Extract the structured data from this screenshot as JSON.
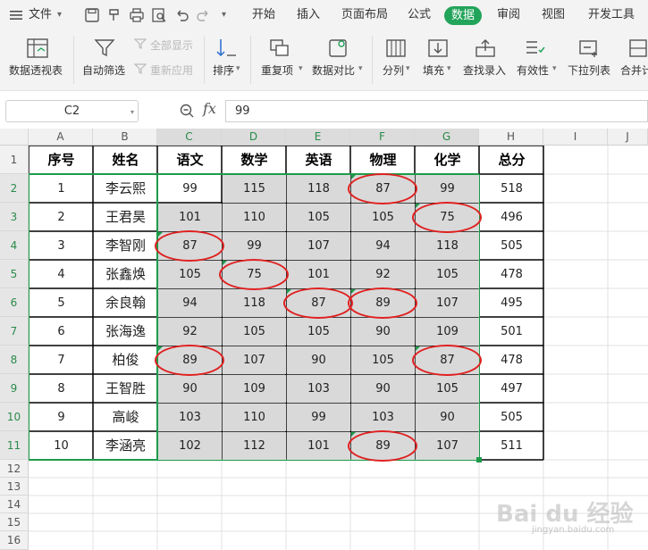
{
  "menubar": {
    "file_label": "文件",
    "file_caret": "▾",
    "more_label": "▾",
    "tabs": [
      "开始",
      "插入",
      "页面布局",
      "公式",
      "数据",
      "审阅",
      "视图",
      "开发工具"
    ],
    "active_tab": "数据",
    "accent": "#22a45a"
  },
  "ribbon": {
    "buttons": [
      {
        "label": "数据透视表",
        "icon": "pivot-table-icon"
      },
      {
        "label": "自动筛选",
        "icon": "filter-icon"
      },
      {
        "label": "排序",
        "icon": "sort-icon",
        "dropdown": true
      },
      {
        "label": "重复项",
        "icon": "duplicates-icon",
        "dropdown": true
      },
      {
        "label": "数据对比",
        "icon": "compare-icon",
        "dropdown": true
      },
      {
        "label": "分列",
        "icon": "split-column-icon",
        "dropdown": true
      },
      {
        "label": "填充",
        "icon": "fill-icon",
        "dropdown": true
      },
      {
        "label": "查找录入",
        "icon": "lookup-entry-icon"
      },
      {
        "label": "有效性",
        "icon": "validation-icon",
        "dropdown": true
      },
      {
        "label": "下拉列表",
        "icon": "dropdown-list-icon"
      },
      {
        "label": "合并计",
        "icon": "consolidate-icon"
      }
    ],
    "show_all": "全部显示",
    "reapply": "重新应用",
    "dropdown_caret": "▾"
  },
  "formula_bar": {
    "name_box": "C2",
    "fx": "fx",
    "value": "99"
  },
  "columns": [
    "A",
    "B",
    "C",
    "D",
    "E",
    "F",
    "G",
    "H",
    "I",
    "J"
  ],
  "rows": [
    "1",
    "2",
    "3",
    "4",
    "5",
    "6",
    "7",
    "8",
    "9",
    "10",
    "11",
    "12",
    "13",
    "14",
    "15",
    "16"
  ],
  "table": {
    "headers": [
      "序号",
      "姓名",
      "语文",
      "数学",
      "英语",
      "物理",
      "化学",
      "总分"
    ],
    "records": [
      [
        "1",
        "李云熙",
        "99",
        "115",
        "118",
        "87",
        "99",
        "518"
      ],
      [
        "2",
        "王君昊",
        "101",
        "110",
        "105",
        "105",
        "75",
        "496"
      ],
      [
        "3",
        "李智刚",
        "87",
        "99",
        "107",
        "94",
        "118",
        "505"
      ],
      [
        "4",
        "张鑫焕",
        "105",
        "75",
        "101",
        "92",
        "105",
        "478"
      ],
      [
        "5",
        "余良翰",
        "94",
        "118",
        "87",
        "89",
        "107",
        "495"
      ],
      [
        "6",
        "张海逸",
        "92",
        "105",
        "105",
        "90",
        "109",
        "501"
      ],
      [
        "7",
        "柏俊",
        "89",
        "107",
        "90",
        "105",
        "87",
        "478"
      ],
      [
        "8",
        "王智胜",
        "90",
        "109",
        "103",
        "90",
        "105",
        "497"
      ],
      [
        "9",
        "高峻",
        "103",
        "110",
        "99",
        "103",
        "90",
        "505"
      ],
      [
        "10",
        "李涵亮",
        "102",
        "112",
        "101",
        "89",
        "107",
        "511"
      ]
    ]
  },
  "highlighted_cells": [
    "F2",
    "G3",
    "C4",
    "D5",
    "E6",
    "F6",
    "C8",
    "G8",
    "F11"
  ],
  "watermark": "Bai du 经验",
  "watermark_sub": "jingyan.baidu.com",
  "colors": {
    "selection_border": "#1e9b4a",
    "selection_fill": "#d9d9d9",
    "circle": "#e02020"
  }
}
